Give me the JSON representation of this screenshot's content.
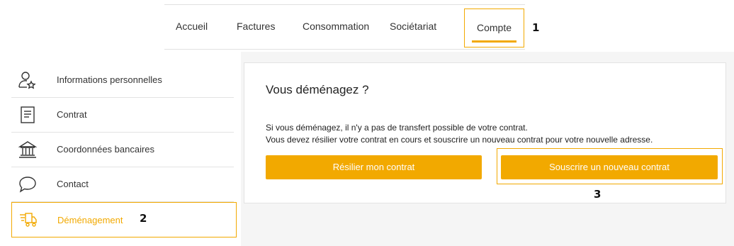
{
  "nav": {
    "tabs": [
      {
        "label": "Accueil"
      },
      {
        "label": "Factures"
      },
      {
        "label": "Consommation"
      },
      {
        "label": "Sociétariat"
      },
      {
        "label": "Compte"
      }
    ],
    "active": "Compte"
  },
  "annotations": [
    "1",
    "2",
    "3"
  ],
  "sidebar": {
    "items": [
      {
        "label": "Informations personnelles",
        "icon": "user-star-icon"
      },
      {
        "label": "Contrat",
        "icon": "document-icon"
      },
      {
        "label": "Coordonnées bancaires",
        "icon": "bank-icon"
      },
      {
        "label": "Contact",
        "icon": "chat-bubble-icon"
      },
      {
        "label": "Déménagement",
        "icon": "moving-truck-icon"
      }
    ],
    "active": "Déménagement"
  },
  "panel": {
    "title": "Vous déménagez ?",
    "line1": "Si vous déménagez, il n'y a pas de transfert possible de votre contrat.",
    "line2": "Vous devez résilier votre contrat en cours et souscrire un nouveau contrat pour votre nouvelle adresse.",
    "cancel_label": "Résilier mon contrat",
    "subscribe_label": "Souscrire un nouveau contrat"
  },
  "colors": {
    "accent": "#f2a900"
  }
}
